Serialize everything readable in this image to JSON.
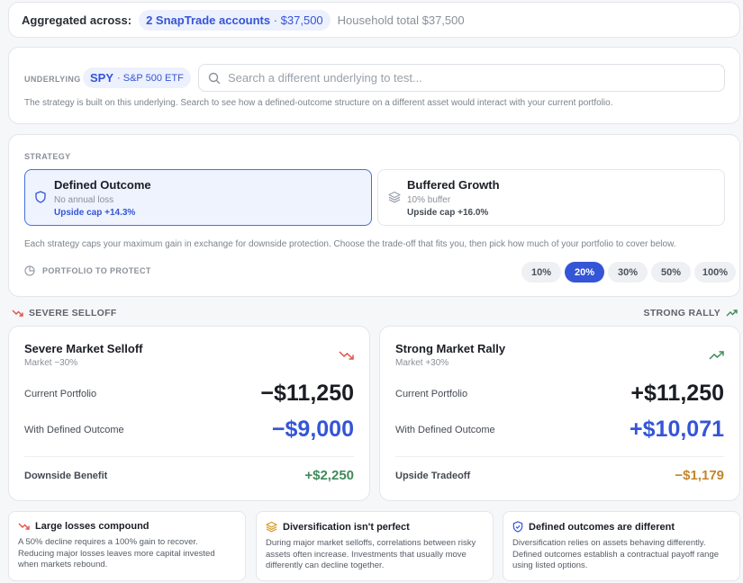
{
  "aggregate": {
    "label": "Aggregated across:",
    "accounts_label": "2 SnapTrade accounts",
    "accounts_amount": "· $37,500",
    "household_total": "Household total $37,500"
  },
  "underlying": {
    "label": "UNDERLYING",
    "symbol": "SPY",
    "symbol_name": "· S&P 500 ETF",
    "search_placeholder": "Search a different underlying to test...",
    "description": "The strategy is built on this underlying. Search to see how a defined-outcome structure on a different asset would interact with your current portfolio."
  },
  "strategy": {
    "label": "STRATEGY",
    "options": [
      {
        "title": "Defined Outcome",
        "subtitle": "No annual loss",
        "cap": "Upside cap +14.3%",
        "selected": true,
        "icon": "shield-icon"
      },
      {
        "title": "Buffered Growth",
        "subtitle": "10% buffer",
        "cap": "Upside cap +16.0%",
        "selected": false,
        "icon": "layers-icon"
      }
    ],
    "description": "Each strategy caps your maximum gain in exchange for downside protection. Choose the trade-off that fits you, then pick how much of your portfolio to cover below.",
    "protect_label": "PORTFOLIO TO PROTECT",
    "percents": [
      "10%",
      "20%",
      "30%",
      "50%",
      "100%"
    ],
    "selected_percent": "20%"
  },
  "scenario_header": {
    "left": "SEVERE SELLOFF",
    "right": "STRONG RALLY"
  },
  "scenarios": [
    {
      "title": "Severe Market Selloff",
      "subtitle": "Market −30%",
      "current_label": "Current Portfolio",
      "current_value": "−$11,250",
      "defined_label": "With Defined Outcome",
      "defined_value": "−$9,000",
      "bottom_label": "Downside Benefit",
      "bottom_value": "+$2,250",
      "bottom_color": "#3f8a5a",
      "icon": "trend-down-icon",
      "icon_color": "#e0524a"
    },
    {
      "title": "Strong Market Rally",
      "subtitle": "Market +30%",
      "current_label": "Current Portfolio",
      "current_value": "+$11,250",
      "defined_label": "With Defined Outcome",
      "defined_value": "+$10,071",
      "bottom_label": "Upside Tradeoff",
      "bottom_value": "−$1,179",
      "bottom_color": "#c4862a",
      "icon": "trend-up-icon",
      "icon_color": "#3f8a5a"
    }
  ],
  "info_cards": [
    {
      "title": "Large losses compound",
      "body": "A 50% decline requires a 100% gain to recover. Reducing major losses leaves more capital invested when markets rebound.",
      "icon": "trend-down-icon"
    },
    {
      "title": "Diversification isn't perfect",
      "body": "During major market selloffs, correlations between risky assets often increase. Investments that usually move differently can decline together.",
      "icon": "layers-icon"
    },
    {
      "title": "Defined outcomes are different",
      "body": "Diversification relies on assets behaving differently. Defined outcomes establish a contractual payoff range using listed options.",
      "icon": "shield-check-icon"
    }
  ],
  "colors": {
    "accent": "#3455d6",
    "positive": "#3f8a5a",
    "negative": "#e0524a",
    "warning": "#c4862a"
  }
}
